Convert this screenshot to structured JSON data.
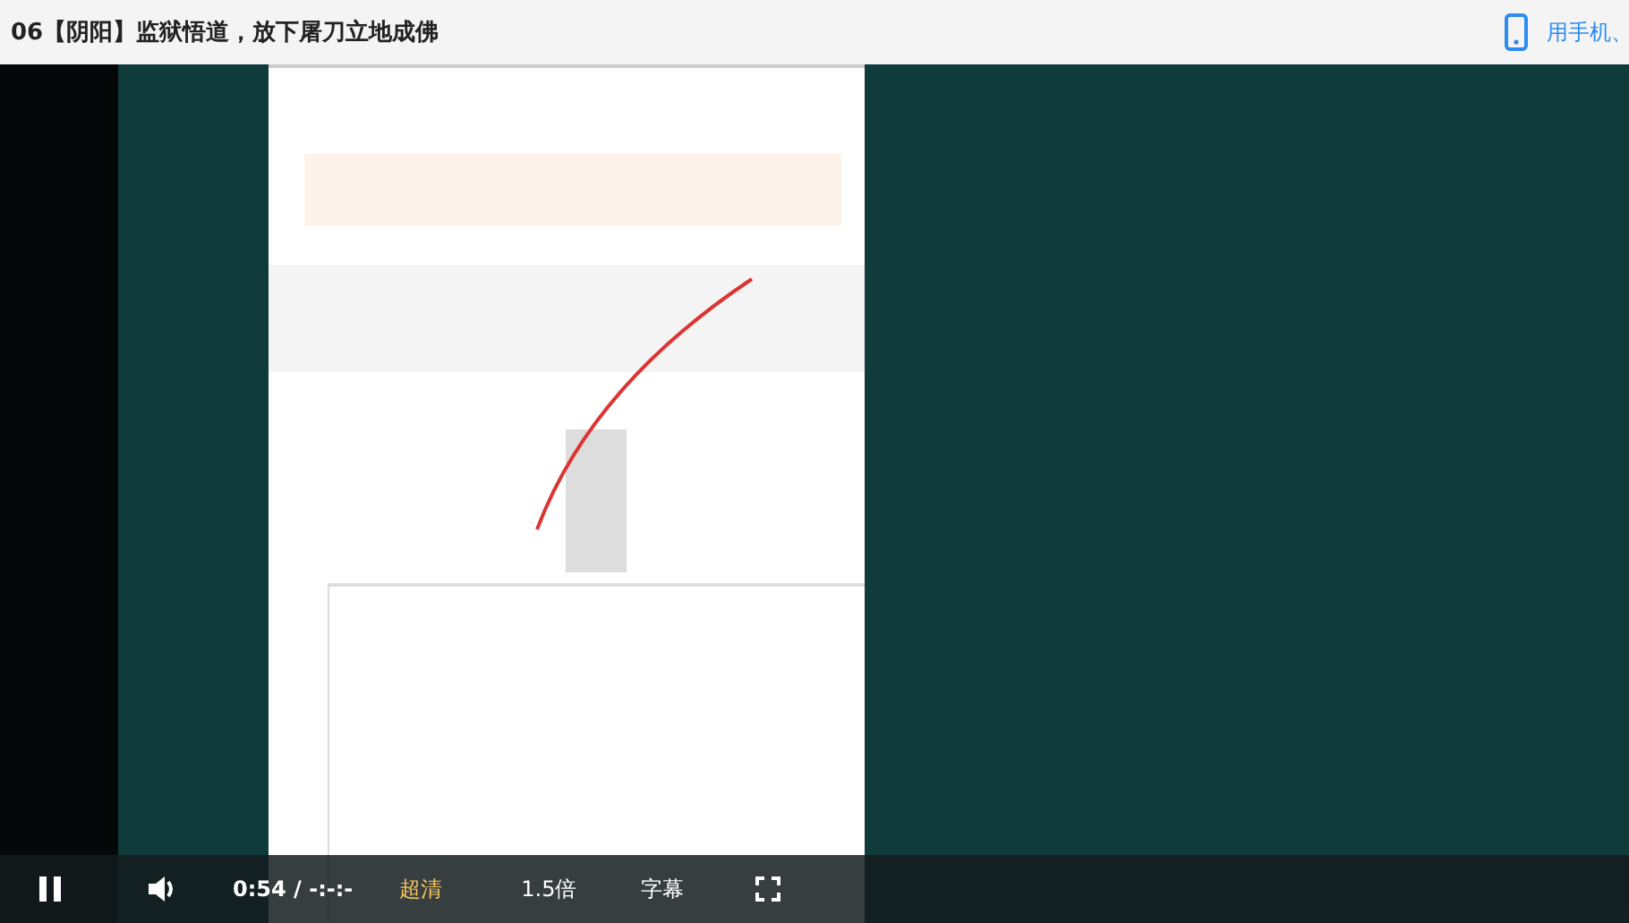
{
  "header": {
    "title": "06【阴阳】监狱悟道，放下屠刀立地成佛",
    "mobile_link": "用手机、"
  },
  "video": {
    "kind": "picture",
    "controls": {
      "playing": true,
      "time": "0:54 / -:-:-",
      "quality": "超清",
      "speed": "1.5倍",
      "subtitles": "字幕"
    }
  }
}
